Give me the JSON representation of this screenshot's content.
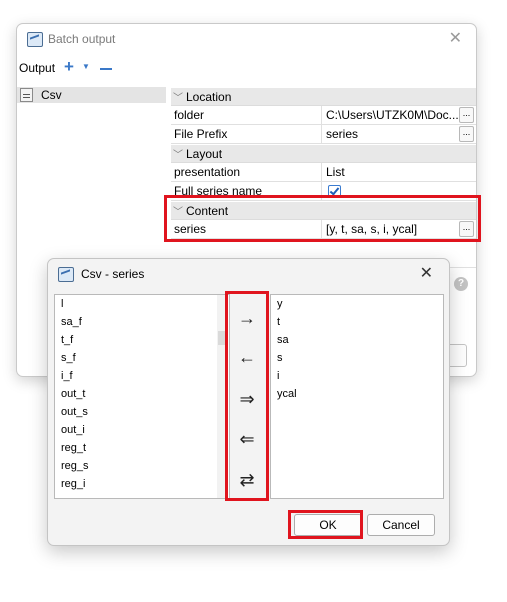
{
  "batch_window": {
    "title": "Batch output",
    "close_glyph": "✕",
    "toolbar": {
      "label": "Output",
      "add_icon": "plus-icon",
      "remove_icon": "minus-icon"
    },
    "outputs": [
      {
        "label": "Csv"
      }
    ],
    "sections": [
      {
        "label": "Location",
        "rows": [
          {
            "name": "folder",
            "value": "C:\\Users\\UTZK0M\\Doc...",
            "has_button": true
          },
          {
            "name": "File Prefix",
            "value": "series",
            "has_button": true
          }
        ]
      },
      {
        "label": "Layout",
        "rows": [
          {
            "name": "presentation",
            "value": "List",
            "has_button": false
          },
          {
            "name": "Full series name",
            "checked": true
          }
        ]
      },
      {
        "label": "Content",
        "rows": [
          {
            "name": "series",
            "value": "[y, t, sa, s, i, ycal]",
            "has_button": true
          }
        ]
      }
    ],
    "ellipsis": "...",
    "help_glyph": "?"
  },
  "csv_dialog": {
    "title": "Csv - series",
    "close_glyph": "✕",
    "available": [
      "l",
      "sa_f",
      "t_f",
      "s_f",
      "i_f",
      "out_t",
      "out_s",
      "out_i",
      "reg_t",
      "reg_s",
      "reg_i"
    ],
    "selected": [
      "y",
      "t",
      "sa",
      "s",
      "i",
      "ycal"
    ],
    "move_buttons": [
      "→",
      "←",
      "⇒",
      "⇐",
      "⇄"
    ],
    "ok_label": "OK",
    "cancel_label": "Cancel"
  },
  "colors": {
    "highlight": "#e0141e",
    "accent": "#3a78c8"
  }
}
